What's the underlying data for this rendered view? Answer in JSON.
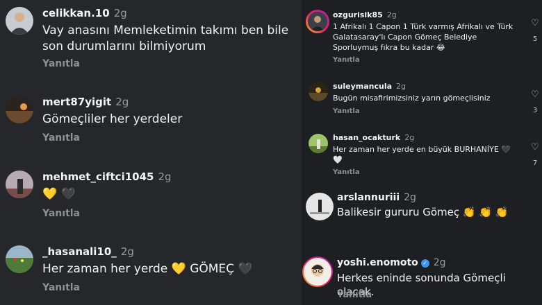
{
  "left_comments": [
    {
      "username": "celikkan.10",
      "time": "2g",
      "text": "Vay anasını Memleketimin takımı ben bile son durumlarını bilmiyorum",
      "reply": "Yanıtla",
      "avatar_color": "#8a8f96"
    },
    {
      "username": "mert87yigit",
      "time": "2g",
      "text": "Gömeçliler her yerdeler",
      "reply": "Yanıtla",
      "avatar_color": "#6b4a2e"
    },
    {
      "username": "mehmet_ciftci1045",
      "time": "2g",
      "text": "💛 🖤",
      "reply": "Yanıtla",
      "avatar_color": "#b8aab3"
    },
    {
      "username": "_hasanali10_",
      "time": "2g",
      "text": "Her zaman her yerde 💛 GÖMEÇ 🖤",
      "reply": "Yanıtla",
      "avatar_color": "#4f7a3a"
    }
  ],
  "right_comments": [
    {
      "username": "ozgurisik85",
      "time": "2g",
      "text": "1 Afrikalı 1 Capon 1 Türk varmış Afrikalı ve Türk Galatasaray'lı Capon Gömeç Belediye Sporluymuş fıkra bu kadar 😂",
      "reply": "Yanıtla",
      "likes": "5",
      "avatar_color": "#3a4048"
    },
    {
      "username": "suleymancula",
      "time": "2g",
      "text": "Bugün misafirimizsiniz yarın gömeçlisiniz",
      "reply": "Yanıtla",
      "likes": "3",
      "avatar_color": "#5a4a28"
    },
    {
      "username": "hasan_ocakturk",
      "time": "2g",
      "text": "Her zaman her yerde en büyük BURHANİYE 🖤 🤍",
      "reply": "Yanıtla",
      "likes": "7",
      "avatar_color": "#5f7a32"
    },
    {
      "username": "arslannuriii",
      "time": "2g",
      "text": "Balikesir gururu Gömeç 👏 👏 👏",
      "reply": "Yanıtla",
      "avatar_color": "#d9d9d9"
    },
    {
      "username": "yoshi.enomoto",
      "time": "2g",
      "text": "Herkes eninde sonunda Gömeçli olacak.",
      "reply": "Yanıtla",
      "verified": "✓",
      "avatar_color": "#e8c9a8"
    }
  ],
  "icons": {
    "heart": "♡"
  }
}
